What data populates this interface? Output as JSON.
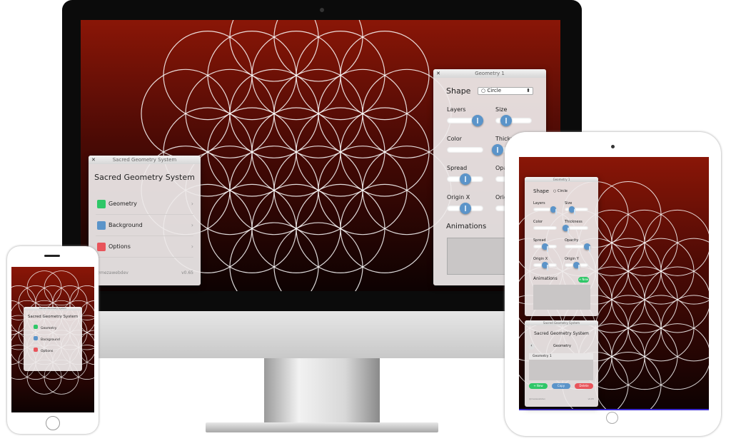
{
  "app": {
    "title": "Sacred Geometry System",
    "handle": "@mezawebdev",
    "version": "v0.65"
  },
  "menu": [
    {
      "label": "Geometry",
      "color": "#2fc768"
    },
    {
      "label": "Background",
      "color": "#5b94c9"
    },
    {
      "label": "Options",
      "color": "#e8545b"
    }
  ],
  "geometry_panel": {
    "title": "Geometry 1",
    "shape_label": "Shape",
    "shape_value": "Circle",
    "animations": "Animations",
    "new_label": "+ New",
    "sliders": [
      {
        "label": "Layers",
        "value": 0.85
      },
      {
        "label": "Size",
        "value": 0.3
      },
      {
        "label": "Color",
        "value": null
      },
      {
        "label": "Thickness",
        "value": 0.05
      },
      {
        "label": "Spread",
        "value": 0.5
      },
      {
        "label": "Opacity",
        "value": 0.95
      },
      {
        "label": "Origin X",
        "value": 0.5
      },
      {
        "label": "Origin Y",
        "value": 0.5
      }
    ]
  },
  "list_panel": {
    "section": "Geometry",
    "back": "‹",
    "items": [
      "Geometry 1"
    ],
    "new": "+ New",
    "copy": "Copy",
    "delete": "Delete"
  },
  "colors": {
    "bg_top": "#8a1607",
    "bg_bottom": "#0d0202",
    "blue": "#5b94c9",
    "green": "#2fc768",
    "red": "#e8545b"
  }
}
